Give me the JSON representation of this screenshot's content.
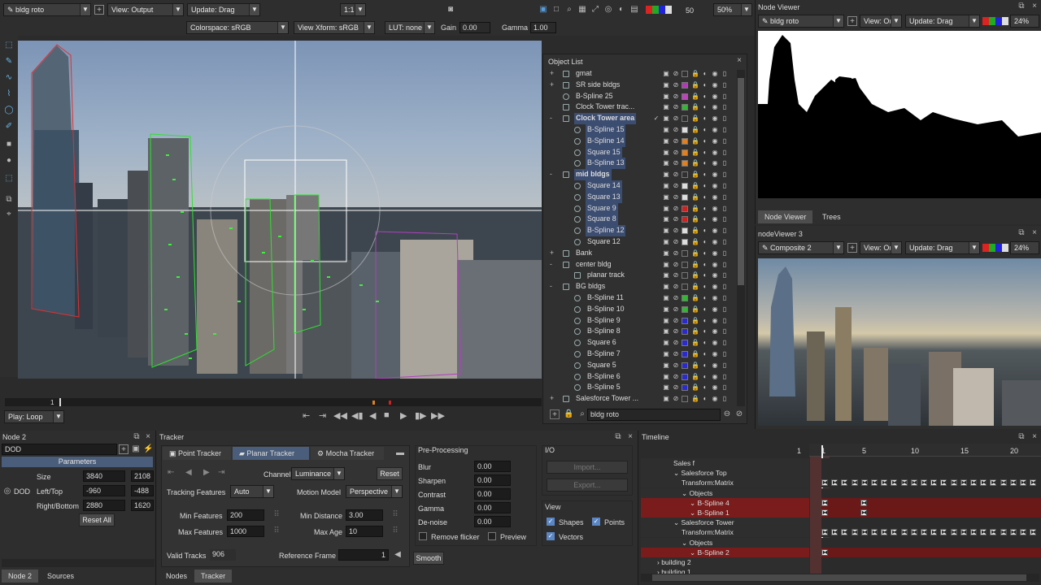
{
  "viewer": {
    "node_select": "bldg roto",
    "view_select": "View: Output",
    "update_select": "Update: Drag",
    "ratio": "1:1",
    "frame_num": "50",
    "zoom": "50%",
    "colorspace": "Colorspace: sRGB",
    "view_xform": "View Xform: sRGB",
    "lut": "LUT: none",
    "gain_label": "Gain",
    "gain_value": "0.00",
    "gamma_label": "Gamma",
    "gamma_value": "1.00",
    "play_mode": "Play: Loop",
    "current_frame": "1"
  },
  "object_list": {
    "title": "Object List",
    "search_value": "bldg roto",
    "rows": [
      {
        "name": "gmat",
        "indent": 0,
        "exp": "+",
        "ic": "g",
        "sw": ""
      },
      {
        "name": "SR side bldgs",
        "indent": 0,
        "exp": "+",
        "ic": "g",
        "sw": "#b03ab8"
      },
      {
        "name": "B-Spline 25",
        "indent": 0,
        "exp": "",
        "ic": "s",
        "sw": "#bb44bb"
      },
      {
        "name": "Clock Tower trac...",
        "indent": 0,
        "exp": "",
        "ic": "p",
        "sw": "#35b535"
      },
      {
        "name": "Clock Tower area",
        "indent": 0,
        "exp": "-",
        "ic": "g",
        "sw": "",
        "sel": true
      },
      {
        "name": "B-Spline 15",
        "indent": 1,
        "exp": "",
        "ic": "s",
        "sw": "#dddddd",
        "sel": true
      },
      {
        "name": "B-Spline 14",
        "indent": 1,
        "exp": "",
        "ic": "s",
        "sw": "#e08020",
        "sel": true
      },
      {
        "name": "Square 15",
        "indent": 1,
        "exp": "",
        "ic": "s",
        "sw": "#e08020",
        "sel": true
      },
      {
        "name": "B-Spline 13",
        "indent": 1,
        "exp": "",
        "ic": "s",
        "sw": "#e08020",
        "sel": true
      },
      {
        "name": "mid bldgs",
        "indent": 0,
        "exp": "-",
        "ic": "g",
        "sw": "",
        "sel": true
      },
      {
        "name": "Square 14",
        "indent": 1,
        "exp": "",
        "ic": "s",
        "sw": "#dddddd",
        "sel": true
      },
      {
        "name": "Square 13",
        "indent": 1,
        "exp": "",
        "ic": "s",
        "sw": "#dddddd",
        "sel": true
      },
      {
        "name": "Square 9",
        "indent": 1,
        "exp": "",
        "ic": "s",
        "sw": "#d02020",
        "sel": true
      },
      {
        "name": "Square 8",
        "indent": 1,
        "exp": "",
        "ic": "s",
        "sw": "#d02020",
        "sel": true
      },
      {
        "name": "B-Spline 12",
        "indent": 1,
        "exp": "",
        "ic": "s",
        "sw": "#dddddd",
        "sel": true
      },
      {
        "name": "Square 12",
        "indent": 1,
        "exp": "",
        "ic": "s",
        "sw": "#dddddd"
      },
      {
        "name": "Bank",
        "indent": 0,
        "exp": "+",
        "ic": "g",
        "sw": ""
      },
      {
        "name": "center bldg",
        "indent": 0,
        "exp": "-",
        "ic": "g",
        "sw": ""
      },
      {
        "name": "planar track",
        "indent": 1,
        "exp": "",
        "ic": "p",
        "sw": ""
      },
      {
        "name": "BG bldgs",
        "indent": 0,
        "exp": "-",
        "ic": "g",
        "sw": ""
      },
      {
        "name": "B-Spline 11",
        "indent": 1,
        "exp": "",
        "ic": "s",
        "sw": "#35b535"
      },
      {
        "name": "B-Spline 10",
        "indent": 1,
        "exp": "",
        "ic": "s",
        "sw": "#35b535"
      },
      {
        "name": "B-Spline 9",
        "indent": 1,
        "exp": "",
        "ic": "s",
        "sw": "#2a2ad0"
      },
      {
        "name": "B-Spline 8",
        "indent": 1,
        "exp": "",
        "ic": "s",
        "sw": "#2a2ad0"
      },
      {
        "name": "Square 6",
        "indent": 1,
        "exp": "",
        "ic": "s",
        "sw": "#2a2ad0"
      },
      {
        "name": "B-Spline 7",
        "indent": 1,
        "exp": "",
        "ic": "s",
        "sw": "#2a2ad0"
      },
      {
        "name": "Square 5",
        "indent": 1,
        "exp": "",
        "ic": "s",
        "sw": "#2a2ad0"
      },
      {
        "name": "B-Spline 6",
        "indent": 1,
        "exp": "",
        "ic": "s",
        "sw": "#2a2ad0"
      },
      {
        "name": "B-Spline 5",
        "indent": 1,
        "exp": "",
        "ic": "s",
        "sw": "#2a2ad0"
      },
      {
        "name": "Salesforce Tower ...",
        "indent": 0,
        "exp": "+",
        "ic": "g",
        "sw": ""
      }
    ]
  },
  "node_viewer": {
    "title": "Node Viewer",
    "node_select": "bldg roto",
    "view_select": "View: Ou",
    "update_select": "Update: Drag",
    "zoom": "24%",
    "tab_node_viewer": "Node Viewer",
    "tab_trees": "Trees"
  },
  "node_viewer3": {
    "title": "nodeViewer 3",
    "node_select": "Composite 2",
    "view_select": "View: Ou",
    "update_select": "Update: Drag",
    "zoom": "24%"
  },
  "node_panel": {
    "title": "Node 2",
    "name_value": "DOD",
    "parameters_tab": "Parameters",
    "size_label": "Size",
    "size_w": "3840",
    "size_h": "2108",
    "dod_label": "DOD",
    "lefttop_label": "Left/Top",
    "lefttop_x": "-960",
    "lefttop_y": "-488",
    "rightbottom_label": "Right/Bottom",
    "rightbottom_x": "2880",
    "rightbottom_y": "1620",
    "reset_all": "Reset All",
    "tab_node2": "Node 2",
    "tab_sources": "Sources"
  },
  "tracker": {
    "title": "Tracker",
    "tab_point": "Point Tracker",
    "tab_planar": "Planar Tracker",
    "tab_mocha": "Mocha Tracker",
    "channel_label": "Channel",
    "channel_value": "Luminance",
    "reset": "Reset",
    "tracking_features_label": "Tracking Features",
    "tracking_features_value": "Auto",
    "motion_model_label": "Motion Model",
    "motion_model_value": "Perspective",
    "min_features_label": "Min Features",
    "min_features_value": "200",
    "min_distance_label": "Min Distance",
    "min_distance_value": "3.00",
    "max_features_label": "Max Features",
    "max_features_value": "1000",
    "max_age_label": "Max Age",
    "max_age_value": "10",
    "valid_tracks_label": "Valid Tracks",
    "valid_tracks_value": "906",
    "reference_frame_label": "Reference Frame",
    "reference_frame_value": "1",
    "preprocessing_title": "Pre-Processing",
    "blur_label": "Blur",
    "blur_value": "0.00",
    "sharpen_label": "Sharpen",
    "sharpen_value": "0.00",
    "contrast_label": "Contrast",
    "contrast_value": "0.00",
    "gamma_label": "Gamma",
    "gamma_value": "0.00",
    "denoise_label": "De-noise",
    "denoise_value": "0.00",
    "remove_flicker": "Remove flicker",
    "preview": "Preview",
    "smooth": "Smooth",
    "io_title": "I/O",
    "import": "Import...",
    "export": "Export...",
    "view_title": "View",
    "shapes": "Shapes",
    "points": "Points",
    "vectors": "Vectors",
    "tab_nodes": "Nodes",
    "tab_tracker": "Tracker"
  },
  "timeline": {
    "title": "Timeline",
    "ruler": [
      "1",
      "1",
      "5",
      "10",
      "15",
      "20"
    ],
    "rows": [
      {
        "label": "Sales f",
        "indent": 4,
        "type": "blank"
      },
      {
        "label": "Salesforce Top",
        "indent": 4,
        "type": "group"
      },
      {
        "label": "Transform:Matrix",
        "indent": 5,
        "type": "keys"
      },
      {
        "label": "Objects",
        "indent": 5,
        "type": "group"
      },
      {
        "label": "B-Spline 4",
        "indent": 6,
        "type": "red"
      },
      {
        "label": "B-Spline 1",
        "indent": 6,
        "type": "red"
      },
      {
        "label": "Salesforce Tower",
        "indent": 4,
        "type": "group"
      },
      {
        "label": "Transform:Matrix",
        "indent": 5,
        "type": "keys"
      },
      {
        "label": "Objects",
        "indent": 5,
        "type": "group"
      },
      {
        "label": "B-Spline 2",
        "indent": 6,
        "type": "redlong"
      },
      {
        "label": "building 2",
        "indent": 2,
        "type": "collapsed"
      },
      {
        "label": "building 1",
        "indent": 2,
        "type": "collapsed"
      }
    ]
  }
}
